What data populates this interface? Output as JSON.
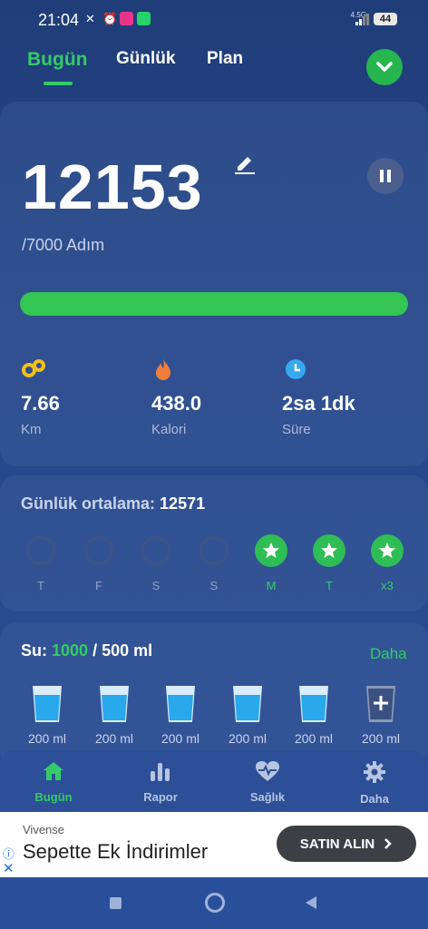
{
  "status_bar": {
    "time": "21:04",
    "network": "4.5G",
    "battery": "44"
  },
  "tabs": [
    {
      "label": "Bugün",
      "active": true
    },
    {
      "label": "Günlük",
      "active": false
    },
    {
      "label": "Plan",
      "active": false
    }
  ],
  "summary": {
    "steps": "12153",
    "goal": "/7000 Adım",
    "progress_fraction": 1.0,
    "stats": [
      {
        "icon": "footprints-icon",
        "value": "7.66",
        "label": "Km",
        "color": "#f2c018"
      },
      {
        "icon": "flame-icon",
        "value": "438.0",
        "label": "Kalori",
        "color": "#f07d3a"
      },
      {
        "icon": "clock-icon",
        "value": "2sa 1dk",
        "label": "Süre",
        "color": "#36a8f0"
      }
    ]
  },
  "average": {
    "label": "Günlük ortalama:",
    "value": "12571",
    "days": [
      {
        "label": "T",
        "done": false
      },
      {
        "label": "F",
        "done": false
      },
      {
        "label": "S",
        "done": false
      },
      {
        "label": "S",
        "done": false
      },
      {
        "label": "M",
        "done": true
      },
      {
        "label": "T",
        "done": true
      },
      {
        "label": "x3",
        "done": true
      }
    ]
  },
  "water": {
    "label": "Su:",
    "current": "1000",
    "target": "/ 500 ml",
    "more_label": "Daha",
    "cups": [
      {
        "label": "200 ml",
        "filled": true
      },
      {
        "label": "200 ml",
        "filled": true
      },
      {
        "label": "200 ml",
        "filled": true
      },
      {
        "label": "200 ml",
        "filled": true
      },
      {
        "label": "200 ml",
        "filled": true
      },
      {
        "label": "200 ml",
        "filled": false
      }
    ]
  },
  "bottom_nav": [
    {
      "label": "Bugün",
      "icon": "home-icon",
      "active": true
    },
    {
      "label": "Rapor",
      "icon": "bar-chart-icon",
      "active": false
    },
    {
      "label": "Sağlık",
      "icon": "heart-pulse-icon",
      "active": false
    },
    {
      "label": "Daha",
      "icon": "gear-icon",
      "active": false
    }
  ],
  "ad": {
    "brand": "Vivense",
    "text": "Sepette Ek İndirimler",
    "button": "SATIN ALIN"
  },
  "colors": {
    "accent": "#33cc66",
    "background": "#26468a"
  }
}
